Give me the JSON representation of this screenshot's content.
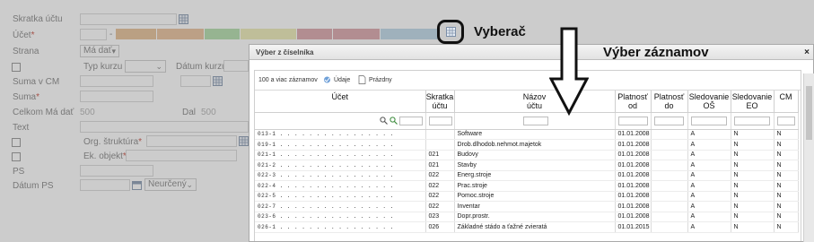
{
  "form": {
    "labels": {
      "skratka_uctu": "Skratka účtu",
      "ucet": "Účet",
      "strana": "Strana",
      "typ_kurzu": "Typ kurzu",
      "datum_kurzu": "Dátum kurzu",
      "suma_v_cm": "Suma v CM",
      "suma": "Suma",
      "celkom_ma_dat": "Celkom Má dať",
      "dal": "Dal",
      "text": "Text",
      "org_struktura": "Org. štruktúra",
      "ek_objekt": "Ek. objekt",
      "ps": "PS",
      "datum_ps": "Dátum PS"
    },
    "required_mark": "*",
    "ucet_separator": "-",
    "strana_value": "Má dať",
    "celkom_ma_dat_value": "500",
    "dal_value": "500",
    "datum_ps_select": "Neurčený",
    "segment_colors": [
      "#e3b98a",
      "#e6b98e",
      "#a8d9a0",
      "#eae8ad",
      "#d59aa1",
      "#d59aa1",
      "#b6d3e6"
    ]
  },
  "annotations": {
    "vyberac": "Vyberač",
    "vyber_zaznamov": "Výber záznamov"
  },
  "dialog": {
    "title": "Výber z číselníka",
    "close": "×",
    "toolbar": {
      "count": "100 a viac záznamov",
      "data_btn": "Údaje",
      "empty_btn": "Prázdny"
    },
    "columns": [
      {
        "l1": "Účet",
        "l2": ""
      },
      {
        "l1": "Skratka",
        "l2": "účtu"
      },
      {
        "l1": "Názov",
        "l2": "účtu"
      },
      {
        "l1": "Platnosť",
        "l2": "od"
      },
      {
        "l1": "Platnosť",
        "l2": "do"
      },
      {
        "l1": "Sledovanie",
        "l2": "OŠ"
      },
      {
        "l1": "Sledovanie",
        "l2": "EO"
      },
      {
        "l1": "CM",
        "l2": ""
      }
    ],
    "rows": [
      {
        "ucet": "013-1 . . . . . . . . . . . . . . . .",
        "skratka": "",
        "nazov": "Software",
        "od": "01.01.2008",
        "do": "",
        "os": "A",
        "eo": "N",
        "cm": "N"
      },
      {
        "ucet": "019-1 . . . . . . . . . . . . . . . .",
        "skratka": "",
        "nazov": "Drob.dlhodob.nehmot.majetok",
        "od": "01.01.2008",
        "do": "",
        "os": "A",
        "eo": "N",
        "cm": "N"
      },
      {
        "ucet": "021-1 . . . . . . . . . . . . . . . .",
        "skratka": "021",
        "nazov": "Budovy",
        "od": "01.01.2008",
        "do": "",
        "os": "A",
        "eo": "N",
        "cm": "N"
      },
      {
        "ucet": "021-2 . . . . . . . . . . . . . . . .",
        "skratka": "021",
        "nazov": "Stavby",
        "od": "01.01.2008",
        "do": "",
        "os": "A",
        "eo": "N",
        "cm": "N"
      },
      {
        "ucet": "022-3 . . . . . . . . . . . . . . . .",
        "skratka": "022",
        "nazov": "Energ.stroje",
        "od": "01.01.2008",
        "do": "",
        "os": "A",
        "eo": "N",
        "cm": "N"
      },
      {
        "ucet": "022-4 . . . . . . . . . . . . . . . .",
        "skratka": "022",
        "nazov": "Prac.stroje",
        "od": "01.01.2008",
        "do": "",
        "os": "A",
        "eo": "N",
        "cm": "N"
      },
      {
        "ucet": "022-5 . . . . . . . . . . . . . . . .",
        "skratka": "022",
        "nazov": "Pomoc.stroje",
        "od": "01.01.2008",
        "do": "",
        "os": "A",
        "eo": "N",
        "cm": "N"
      },
      {
        "ucet": "022-7 . . . . . . . . . . . . . . . .",
        "skratka": "022",
        "nazov": "Inventar",
        "od": "01.01.2008",
        "do": "",
        "os": "A",
        "eo": "N",
        "cm": "N"
      },
      {
        "ucet": "023-6 . . . . . . . . . . . . . . . .",
        "skratka": "023",
        "nazov": "Dopr.prostr.",
        "od": "01.01.2008",
        "do": "",
        "os": "A",
        "eo": "N",
        "cm": "N"
      },
      {
        "ucet": "026-1 . . . . . . . . . . . . . . . .",
        "skratka": "026",
        "nazov": "Základné stádo a ťažné zvieratá",
        "od": "01.01.2015",
        "do": "",
        "os": "A",
        "eo": "N",
        "cm": "N"
      }
    ],
    "icons": [
      "search-icon",
      "clear-filter-icon",
      "data-icon",
      "empty-doc-icon"
    ]
  }
}
